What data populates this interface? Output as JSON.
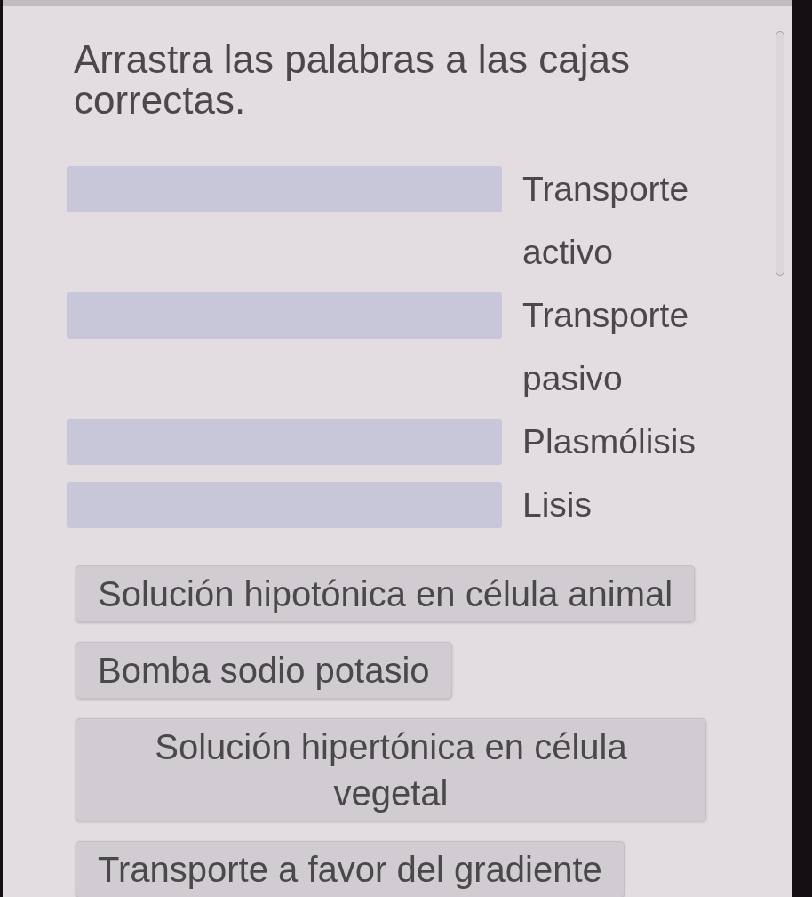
{
  "instruction": "Arrastra las palabras a las cajas correctas.",
  "drop_targets": [
    {
      "label": "Transporte activo"
    },
    {
      "label": "Transporte pasivo"
    },
    {
      "label": "Plasmólisis"
    },
    {
      "label": "Lisis"
    }
  ],
  "word_bank": [
    "Solución hipotónica en célula animal",
    "Bomba sodio potasio",
    "Solución hipertónica en célula vegetal",
    "Transporte a favor del gradiente"
  ]
}
